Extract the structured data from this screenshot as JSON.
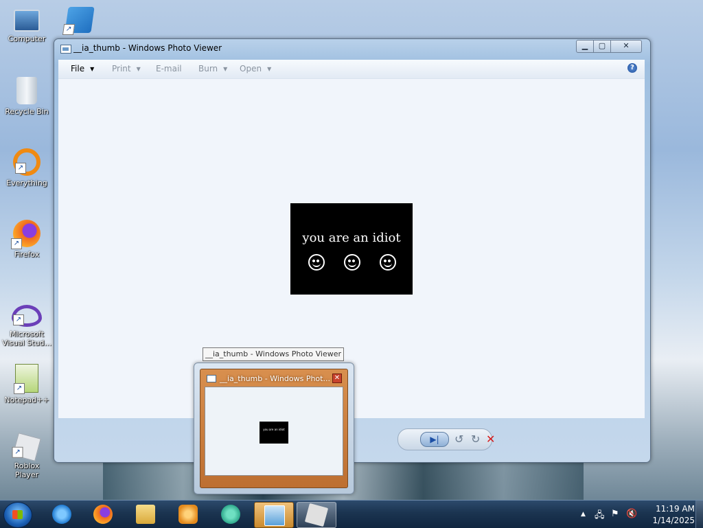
{
  "desktop": {
    "icons": [
      {
        "label": "Computer",
        "icon": "computer-icon"
      },
      {
        "label": "Recycle Bin",
        "icon": "recycle-bin-icon"
      },
      {
        "label": "Everything",
        "icon": "everything-search-icon"
      },
      {
        "label": "Firefox",
        "icon": "firefox-icon"
      },
      {
        "label": "Microsoft Visual Stud...",
        "icon": "visual-studio-icon"
      },
      {
        "label": "Notepad++",
        "icon": "notepad-plus-plus-icon"
      },
      {
        "label": "Roblox Player",
        "icon": "roblox-icon"
      }
    ]
  },
  "window": {
    "title": "__ia_thumb - Windows Photo Viewer",
    "menu": {
      "file": "File",
      "print": "Print",
      "email": "E-mail",
      "burn": "Burn",
      "open": "Open"
    },
    "help": "?",
    "photo_text": "you are an idiot",
    "controls": {
      "play": "▶|",
      "rotate_ccw": "↺",
      "rotate_cw": "↻",
      "delete": "✕"
    }
  },
  "taskbar_preview": {
    "tooltip": "__ia_thumb - Windows Photo Viewer",
    "title": "__ia_thumb - Windows Phot...",
    "close": "✕",
    "mini_text": "you are an idiot"
  },
  "taskbar": {
    "buttons": [
      {
        "icon": "internet-explorer-icon",
        "color": "#3b9ae0"
      },
      {
        "icon": "firefox-icon",
        "color": "#f06b1f"
      },
      {
        "icon": "file-explorer-icon",
        "color": "#e8c55a"
      },
      {
        "icon": "media-player-icon",
        "color": "#e48a1c"
      },
      {
        "icon": "chat-app-icon",
        "color": "#2fb89a"
      },
      {
        "icon": "photo-viewer-icon",
        "color": "#5aa0d8",
        "state": "active"
      },
      {
        "icon": "roblox-icon",
        "color": "#e0e0e0",
        "state": "open"
      }
    ],
    "tray": {
      "show_hidden": "▲",
      "network": "🖧",
      "flag": "⚑",
      "volume": "🔇"
    },
    "clock": {
      "time": "11:19 AM",
      "date": "1/14/2025"
    }
  },
  "colors": {
    "accent": "#1d4f9c",
    "active_task": "#e0a548"
  }
}
